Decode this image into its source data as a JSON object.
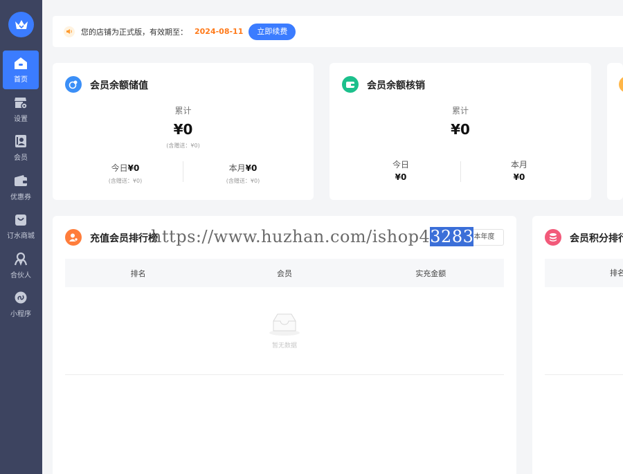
{
  "sidebar": {
    "items": [
      {
        "label": "首页",
        "icon": "home-icon"
      },
      {
        "label": "设置",
        "icon": "store-settings-icon"
      },
      {
        "label": "会员",
        "icon": "member-card-icon"
      },
      {
        "label": "优惠券",
        "icon": "coupon-wallet-icon"
      },
      {
        "label": "订水商城",
        "icon": "shopping-bag-icon"
      },
      {
        "label": "合伙人",
        "icon": "partner-icon"
      },
      {
        "label": "小程序",
        "icon": "mini-program-icon"
      }
    ],
    "active_index": 0
  },
  "notice": {
    "text": "您的店铺为正式版，有效期至：",
    "expire_date": "2024-08-11",
    "renew_label": "立即续费"
  },
  "cards": {
    "stored_value": {
      "title": "会员余额储值",
      "cumulative_label": "累计",
      "cumulative_value": "¥0",
      "cumulative_note": "(含赠送：¥0)",
      "today_label": "今日",
      "today_value": "¥0",
      "today_note": "(含赠送：¥0)",
      "month_label": "本月",
      "month_value": "¥0",
      "month_note": "(含赠送：¥0)"
    },
    "write_off": {
      "title": "会员余额核销",
      "cumulative_label": "累计",
      "cumulative_value": "¥0",
      "today_label": "今日",
      "today_value": "¥0",
      "month_label": "本月",
      "month_value": "¥0"
    }
  },
  "recharge_rank": {
    "title": "充值会员排行榜",
    "filter_label": "本年度",
    "columns": [
      "排名",
      "会员",
      "实充金额"
    ],
    "empty_text": "暂无数据"
  },
  "points_rank": {
    "title": "会员积分排行",
    "columns": [
      "排名"
    ]
  },
  "watermark": {
    "text": "https://www.huzhan.com/ishop4",
    "highlight": "3283"
  },
  "colors": {
    "accent": "#3b7cff",
    "sidebar_bg": "#3d4460",
    "expire_date": "#ff7a1a"
  }
}
